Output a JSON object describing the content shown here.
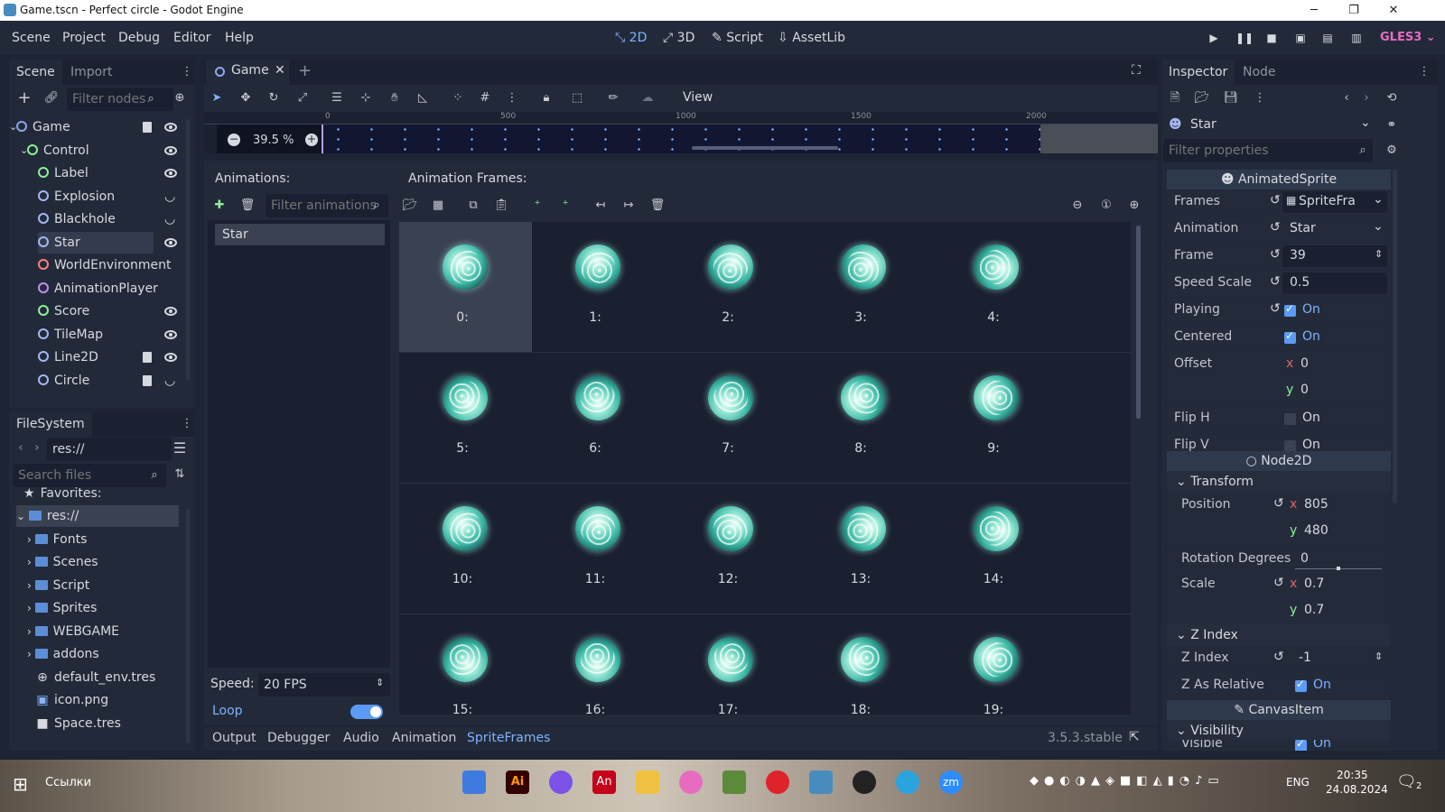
{
  "window": {
    "title": "Game.tscn - Perfect circle - Godot Engine",
    "minimize": "─",
    "maximize": "❐",
    "close": "✕"
  },
  "menu": [
    "Scene",
    "Project",
    "Debug",
    "Editor",
    "Help"
  ],
  "workspaces": [
    {
      "label": "2D",
      "icon": "2d-icon",
      "active": true
    },
    {
      "label": "3D",
      "icon": "3d-icon",
      "active": false
    },
    {
      "label": "Script",
      "icon": "script-icon",
      "active": false
    },
    {
      "label": "AssetLib",
      "icon": "assetlib-icon",
      "active": false
    }
  ],
  "renderer": "GLES3",
  "scene_dock": {
    "tabs": [
      "Scene",
      "Import"
    ],
    "filter_placeholder": "Filter nodes",
    "nodes": [
      {
        "name": "Game",
        "color": "#8da5f3",
        "indent": 0,
        "expanded": true,
        "script": true,
        "visibility": "eye"
      },
      {
        "name": "Control",
        "color": "#8eef97",
        "indent": 1,
        "expanded": true,
        "script": false,
        "visibility": "eye"
      },
      {
        "name": "Label",
        "color": "#8eef97",
        "indent": 2,
        "script": false,
        "visibility": "eye"
      },
      {
        "name": "Explosion",
        "color": "#a5b7f3",
        "indent": 2,
        "script": false,
        "visibility": "hidden"
      },
      {
        "name": "Blackhole",
        "color": "#a5b7f3",
        "indent": 2,
        "script": false,
        "visibility": "hidden"
      },
      {
        "name": "Star",
        "color": "#a5b7f3",
        "indent": 2,
        "script": false,
        "visibility": "eye",
        "selected": true
      },
      {
        "name": "WorldEnvironment",
        "color": "#fc7f7f",
        "indent": 2,
        "script": false,
        "visibility": "none"
      },
      {
        "name": "AnimationPlayer",
        "color": "#c38ef1",
        "indent": 2,
        "script": false,
        "visibility": "none"
      },
      {
        "name": "Score",
        "color": "#8eef97",
        "indent": 2,
        "script": false,
        "visibility": "eye"
      },
      {
        "name": "TileMap",
        "color": "#a5b7f3",
        "indent": 2,
        "script": false,
        "visibility": "eye"
      },
      {
        "name": "Line2D",
        "color": "#a5b7f3",
        "indent": 2,
        "script": true,
        "visibility": "eye"
      },
      {
        "name": "Circle",
        "color": "#a5b7f3",
        "indent": 2,
        "script": true,
        "visibility": "hidden"
      }
    ]
  },
  "filesystem": {
    "tab": "FileSystem",
    "path": "res://",
    "search_placeholder": "Search files",
    "favorites": "Favorites:",
    "items": [
      {
        "name": "res://",
        "type": "root"
      },
      {
        "name": "Fonts",
        "type": "folder"
      },
      {
        "name": "Scenes",
        "type": "folder"
      },
      {
        "name": "Script",
        "type": "folder"
      },
      {
        "name": "Sprites",
        "type": "folder"
      },
      {
        "name": "WEBGAME",
        "type": "folder"
      },
      {
        "name": "addons",
        "type": "folder"
      },
      {
        "name": "default_env.tres",
        "type": "env"
      },
      {
        "name": "icon.png",
        "type": "image"
      },
      {
        "name": "Space.tres",
        "type": "resource"
      }
    ]
  },
  "editor": {
    "scene_tab": "Game",
    "add_tab": "+",
    "view_menu": "View",
    "zoom": "39.5 %",
    "ruler_marks": [
      "0",
      "500",
      "1000",
      "1500",
      "2000"
    ]
  },
  "spriteframes": {
    "animations_title": "Animations:",
    "frames_title": "Animation Frames:",
    "filter_placeholder": "Filter animations",
    "animations": [
      "Star"
    ],
    "frames": [
      "0:",
      "1:",
      "2:",
      "3:",
      "4:",
      "5:",
      "6:",
      "7:",
      "8:",
      "9:",
      "10:",
      "11:",
      "12:",
      "13:",
      "14:",
      "15:",
      "16:",
      "17:",
      "18:",
      "19:"
    ],
    "selected_frame": 0,
    "speed_label": "Speed:",
    "speed_value": "20 FPS",
    "loop_label": "Loop",
    "loop_on": true
  },
  "bottom_tabs": [
    {
      "label": "Output",
      "active": false
    },
    {
      "label": "Debugger",
      "active": false
    },
    {
      "label": "Audio",
      "active": false
    },
    {
      "label": "Animation",
      "active": false
    },
    {
      "label": "SpriteFrames",
      "active": true
    }
  ],
  "version": "3.5.3.stable",
  "inspector": {
    "tabs": [
      "Inspector",
      "Node"
    ],
    "object": "Star",
    "filter_placeholder": "Filter properties",
    "sections": {
      "animated_sprite": "AnimatedSprite",
      "node2d": "Node2D",
      "transform": "Transform",
      "z_index": "Z Index",
      "canvas_item": "CanvasItem",
      "visibility": "Visibility"
    },
    "props": {
      "frames": {
        "label": "Frames",
        "value": "SpriteFra"
      },
      "animation": {
        "label": "Animation",
        "value": "Star"
      },
      "frame": {
        "label": "Frame",
        "value": "39"
      },
      "speed_scale": {
        "label": "Speed Scale",
        "value": "0.5"
      },
      "playing": {
        "label": "Playing",
        "value": "On",
        "checked": true
      },
      "centered": {
        "label": "Centered",
        "value": "On",
        "checked": true
      },
      "offset": {
        "label": "Offset",
        "x": "0",
        "y": "0"
      },
      "flip_h": {
        "label": "Flip H",
        "value": "On",
        "checked": false
      },
      "flip_v": {
        "label": "Flip V",
        "value": "On",
        "checked": false
      },
      "position": {
        "label": "Position",
        "x": "805",
        "y": "480"
      },
      "rotation": {
        "label": "Rotation Degrees",
        "value": "0"
      },
      "scale": {
        "label": "Scale",
        "x": "0.7",
        "y": "0.7"
      },
      "z_index": {
        "label": "Z Index",
        "value": "-1"
      },
      "z_relative": {
        "label": "Z As Relative",
        "value": "On",
        "checked": true
      },
      "visible": {
        "label": "Visible",
        "value": "On",
        "checked": true
      }
    },
    "axis_x": "x",
    "axis_y": "y"
  },
  "taskbar": {
    "search_text": "Ссылки",
    "language": "ENG",
    "time": "20:35",
    "date": "24.08.2024",
    "notifications": "2"
  },
  "colors": {
    "accent": "#5b9bf5",
    "panel": "#222a39",
    "background": "#1d2433",
    "selection": "#3a4252"
  }
}
